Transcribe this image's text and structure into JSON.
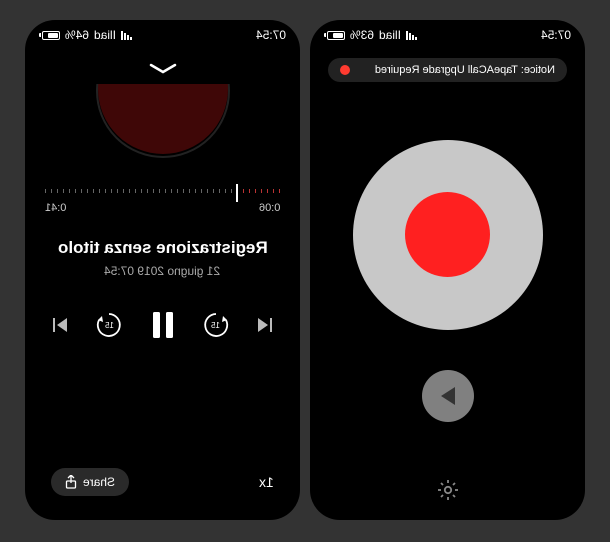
{
  "left": {
    "status": {
      "battery_pct": "64%",
      "carrier": "Iliad",
      "time": "07:54",
      "battery_level": 64
    },
    "timeline": {
      "elapsed": "0:41",
      "remaining": "0:06"
    },
    "title": "Registrazione senza titolo",
    "date": "21 giugno 2019 07:54",
    "seek_back": "15",
    "seek_fwd": "15",
    "share_label": "Share",
    "speed": "1x"
  },
  "right": {
    "status": {
      "battery_pct": "63%",
      "carrier": "Iliad",
      "time": "07:54",
      "battery_level": 63
    },
    "notice": "Notice: TapeACall Upgrade Required"
  }
}
